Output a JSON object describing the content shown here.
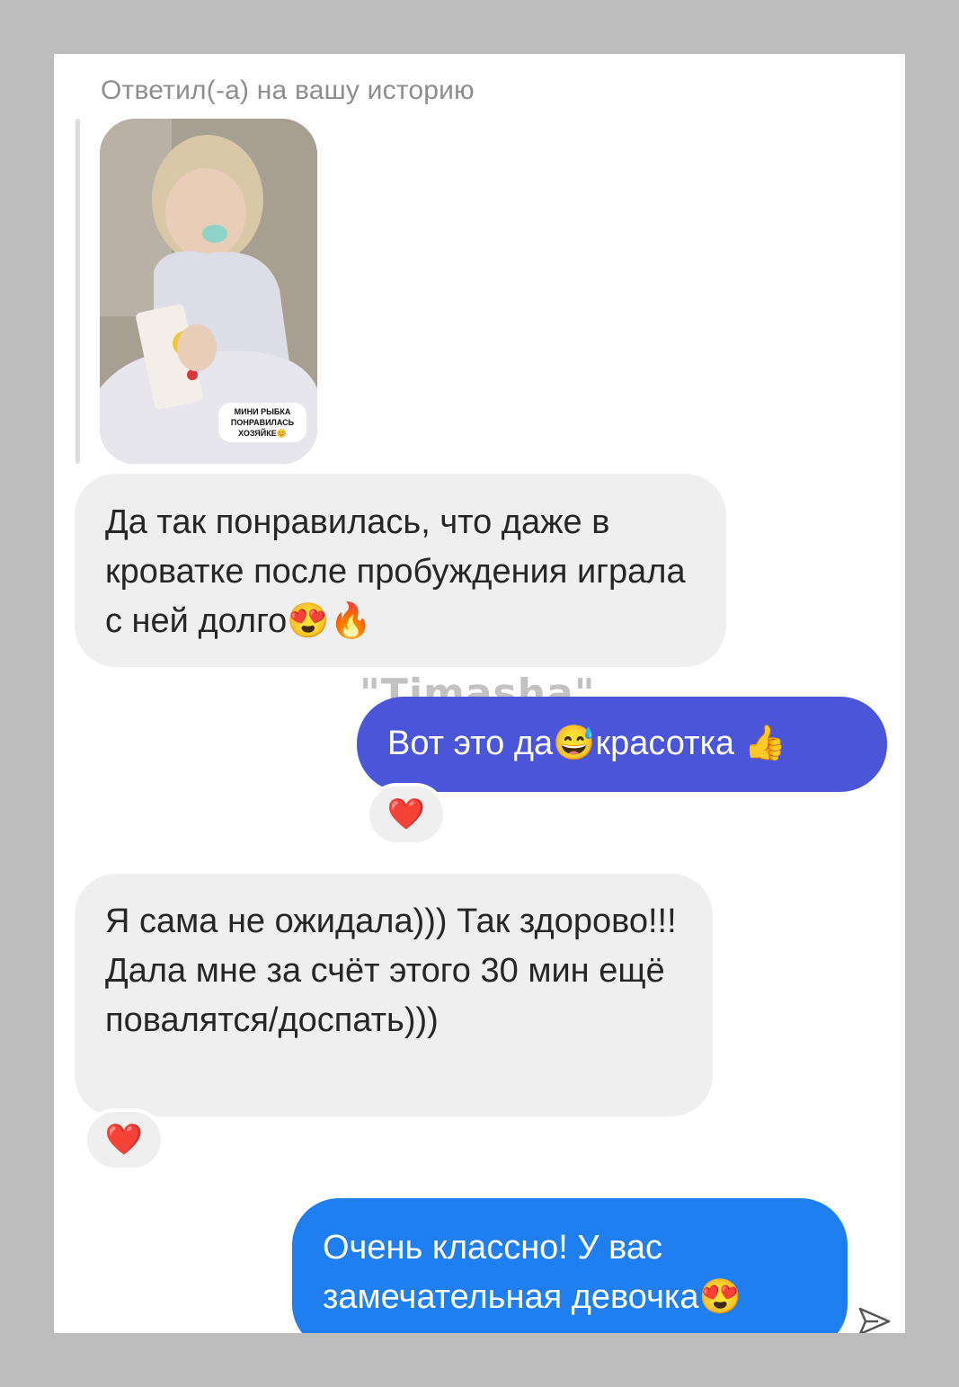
{
  "story_reply": {
    "caption": "Ответил(-а) на вашу историю",
    "sticker_lines": [
      "МИНИ РЫБКА",
      "ПОНРАВИЛАСЬ",
      "ХОЗЯЙКЕ😊"
    ]
  },
  "messages": [
    {
      "direction": "incoming",
      "text": "Да так понравилась, что даже в кроватке после пробуждения играла с ней долго😍🔥"
    },
    {
      "direction": "outgoing",
      "text": "Вот это да😅красотка 👍",
      "reaction": "❤️"
    },
    {
      "direction": "incoming",
      "text_lines": [
        "Я сама не ожидала))) Так здорово!!!",
        "Дала мне за счёт этого 30 мин ещё повалятся/доспать)))"
      ],
      "reaction": "❤️"
    },
    {
      "direction": "outgoing",
      "text": "Очень классно! У вас замечательная девочка😍"
    }
  ],
  "watermark": "\"Timasha\"",
  "icons": {
    "send": "send-icon",
    "reaction": "heart-icon"
  },
  "colors": {
    "incoming_bubble": "#efefef",
    "outgoing_bubble_1": "#4a55d9",
    "outgoing_bubble_2": "#1f7ff0",
    "frame": "#bdbdbd"
  }
}
